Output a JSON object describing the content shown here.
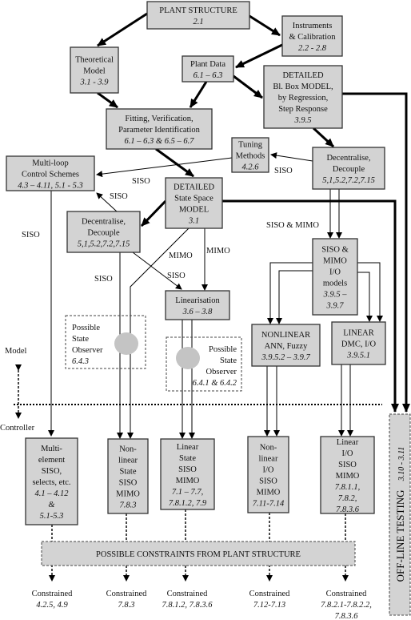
{
  "nodes": {
    "plant_structure": {
      "lines": [
        "PLANT STRUCTURE"
      ],
      "refs": [
        "2.1"
      ]
    },
    "instruments": {
      "lines": [
        "Instruments",
        "& Calibration"
      ],
      "refs": [
        "2.2 - 2.8"
      ]
    },
    "theoretical": {
      "lines": [
        "Theoretical",
        "Model"
      ],
      "refs": [
        "3.1 - 3.9"
      ]
    },
    "plant_data": {
      "lines": [
        "Plant Data"
      ],
      "refs": [
        "6.1 – 6.3"
      ]
    },
    "blackbox": {
      "lines": [
        "DETAILED",
        "Bl. Box MODEL,",
        "by Regression,",
        "Step Response"
      ],
      "refs": [
        "3.9.5"
      ]
    },
    "fitting": {
      "lines": [
        "Fitting, Verification,",
        "Parameter Identification"
      ],
      "refs": [
        "6.1 – 6.3  &  6.5 – 6.7"
      ]
    },
    "tuning": {
      "lines": [
        "Tuning",
        "Methods"
      ],
      "refs": [
        "4.2.6"
      ]
    },
    "decouple_right": {
      "lines": [
        "Decentralise,",
        "Decouple"
      ],
      "refs": [
        "5,1,5.2,7.2,7.15"
      ]
    },
    "multiloop": {
      "lines": [
        "Multi-loop",
        "Control Schemes"
      ],
      "refs": [
        "4.3 – 4.11, 5.1 - 5.3"
      ]
    },
    "state_space": {
      "lines": [
        "DETAILED",
        "State Space",
        "MODEL"
      ],
      "refs": [
        "3.1"
      ]
    },
    "decouple_left": {
      "lines": [
        "Decentralise,",
        "Decouple"
      ],
      "refs": [
        "5,1,5.2,7.2,7.15"
      ]
    },
    "linearisation": {
      "lines": [
        "Linearisation"
      ],
      "refs": [
        "3.6 – 3.8"
      ]
    },
    "io_models": {
      "lines": [
        "SISO &",
        "MIMO",
        "I/O",
        "models"
      ],
      "refs": [
        "3.9.5 –",
        "3.9.7"
      ]
    },
    "nonlinear": {
      "lines": [
        "NONLINEAR",
        "ANN, Fuzzy"
      ],
      "refs": [
        "3.9.5.2 – 3.9.7"
      ]
    },
    "linear_dmc": {
      "lines": [
        "LINEAR",
        "DMC, I/O"
      ],
      "refs": [
        "3.9.5.1"
      ]
    },
    "observer_left": {
      "lines": [
        "Possible",
        "State",
        "Observer"
      ],
      "refs": [
        "6.4.3"
      ]
    },
    "observer_right": {
      "lines": [
        "Possible",
        "State",
        "Observer"
      ],
      "refs": [
        "6.4.1  &  6.4.2"
      ]
    },
    "multi_element": {
      "lines": [
        "Multi-",
        "element",
        "SISO,",
        "selects, etc."
      ],
      "refs": [
        "4.1 – 4.12",
        "&",
        "5.1-5.3"
      ]
    },
    "nonlinear_state": {
      "lines": [
        "Non-",
        "linear",
        "State",
        "SISO",
        "MIMO"
      ],
      "refs": [
        "7.8.3"
      ]
    },
    "linear_state": {
      "lines": [
        "Linear",
        "State",
        "SISO",
        "MIMO"
      ],
      "refs": [
        "7.1 – 7.7,",
        "7.8.1.2, 7.9"
      ]
    },
    "nonlinear_io": {
      "lines": [
        "Non-",
        "linear",
        "I/O",
        "SISO",
        "MIMO"
      ],
      "refs": [
        "7.11-7.14"
      ]
    },
    "linear_io": {
      "lines": [
        "Linear",
        "I/O",
        "SISO",
        "MIMO"
      ],
      "refs": [
        "7.8.1.1,",
        "7.8.2,",
        "7.8.3.6"
      ]
    }
  },
  "edge_labels": {
    "siso_tuning": "SISO",
    "siso_multiloop": "SISO",
    "siso_decouple_left": "SISO",
    "siso_left": "SISO",
    "siso_mid": "SISO",
    "siso_linearisation": "SISO",
    "mimo_left": "MIMO",
    "mimo_right": "MIMO",
    "siso_mimo": "SISO & MIMO"
  },
  "levels": {
    "model": "Model",
    "controller": "Controller"
  },
  "constraints": "POSSIBLE  CONSTRAINTS  FROM  PLANT  STRUCTURE",
  "offline_testing": {
    "label": "OFF-LINE  TESTING",
    "ref": "3.10 - 3.11"
  },
  "constrained": [
    {
      "label": "Constrained",
      "refs": [
        "4.2.5, 4.9"
      ]
    },
    {
      "label": "Constrained",
      "refs": [
        "7.8.3"
      ]
    },
    {
      "label": "Constrained",
      "refs": [
        "7.8.1.2, 7.8.3.6"
      ]
    },
    {
      "label": "Constrained",
      "refs": [
        "7.12-7.13"
      ]
    },
    {
      "label": "Constrained",
      "refs": [
        "7.8.2.1-7.8.2.2,",
        "7.8.3.6"
      ]
    }
  ]
}
